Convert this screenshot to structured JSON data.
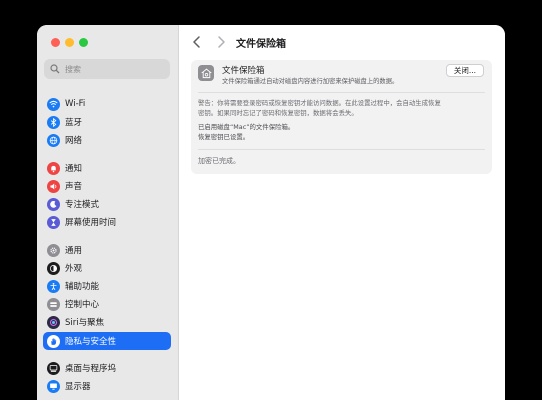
{
  "sidebar": {
    "search_placeholder": "搜索",
    "items": [
      {
        "label": "Wi-Fi",
        "icon": "wifi-icon",
        "color": "#1a7cf5"
      },
      {
        "label": "蓝牙",
        "icon": "bluetooth-icon",
        "color": "#1a7cf5"
      },
      {
        "label": "网络",
        "icon": "globe-icon",
        "color": "#1a7cf5"
      },
      {
        "label": "通知",
        "icon": "bell-icon",
        "color": "#ef4444"
      },
      {
        "label": "声音",
        "icon": "speaker-icon",
        "color": "#ef4444"
      },
      {
        "label": "专注模式",
        "icon": "moon-icon",
        "color": "#5b5bd6"
      },
      {
        "label": "屏幕使用时间",
        "icon": "hourglass-icon",
        "color": "#5b5bd6"
      },
      {
        "label": "通用",
        "icon": "gear-icon",
        "color": "#8e8e93"
      },
      {
        "label": "外观",
        "icon": "appearance-icon",
        "color": "#1c1c1e"
      },
      {
        "label": "辅助功能",
        "icon": "accessibility-icon",
        "color": "#1a7cf5"
      },
      {
        "label": "控制中心",
        "icon": "control-center-icon",
        "color": "#8e8e93"
      },
      {
        "label": "Siri与聚焦",
        "icon": "siri-icon",
        "color": "#2b2b45"
      },
      {
        "label": "隐私与安全性",
        "icon": "hand-icon",
        "color": "#1e6ef5"
      },
      {
        "label": "桌面与程序坞",
        "icon": "dock-icon",
        "color": "#1c1c1e"
      },
      {
        "label": "显示器",
        "icon": "display-icon",
        "color": "#1a7cf5"
      }
    ],
    "selected": "隐私与安全性"
  },
  "header": {
    "title": "文件保险箱"
  },
  "filevault": {
    "title": "文件保险箱",
    "description": "文件保险箱通过自动对磁盘内容进行加密来保护磁盘上的数据。",
    "button_label": "关闭...",
    "warning_line1": "警告：你将需要登录密码或恢复密钥才能访问数据。在此设置过程中，会自动生成恢复",
    "warning_line2": "密钥。如果同时忘记了密码和恢复密钥，数据将会丢失。",
    "enabled_line1": "已启用磁盘“Mac”的文件保险箱。",
    "enabled_line2": "恢复密钥已设置。",
    "status": "加密已完成。"
  }
}
